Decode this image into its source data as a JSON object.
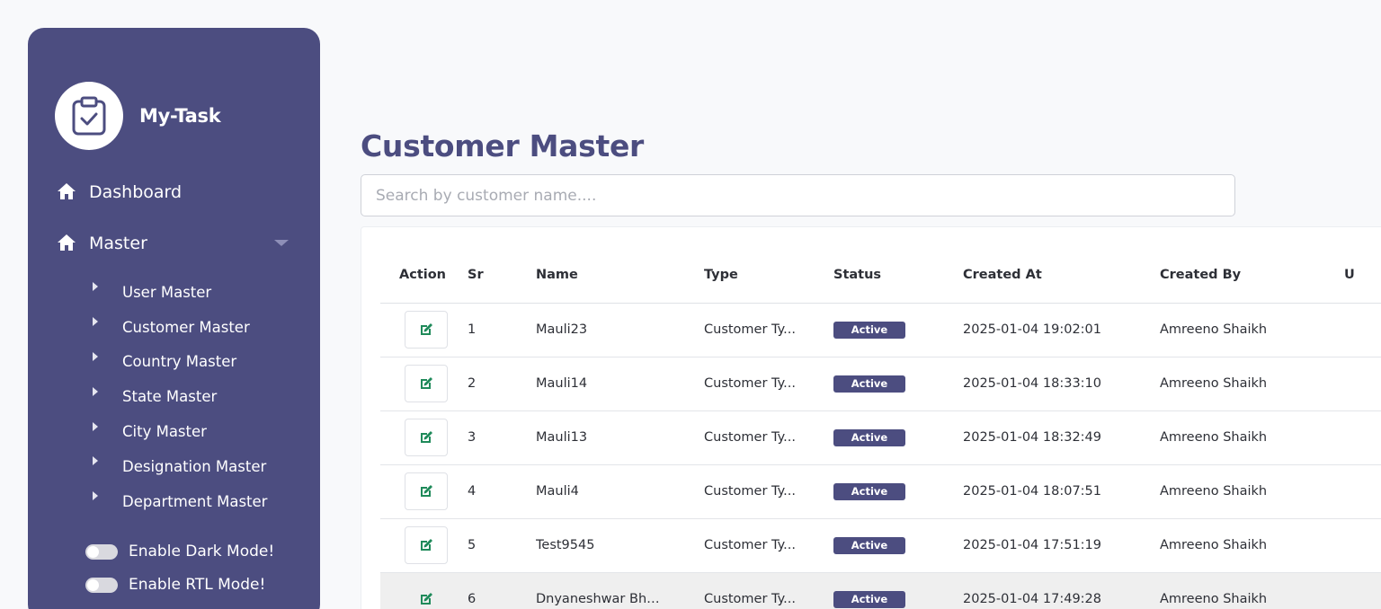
{
  "brand": {
    "name": "My-Task",
    "logo_icon": "clipboard-check-icon"
  },
  "sidebar": {
    "dashboard_label": "Dashboard",
    "master_label": "Master",
    "master_items": [
      "User Master",
      "Customer Master",
      "Country Master",
      "State Master",
      "City Master",
      "Designation Master",
      "Department Master"
    ],
    "dark_mode_label": "Enable Dark Mode!",
    "rtl_mode_label": "Enable RTL Mode!"
  },
  "main": {
    "title": "Customer Master",
    "search_placeholder": "Search by customer name....",
    "table": {
      "columns": [
        "Action",
        "Sr",
        "Name",
        "Type",
        "Status",
        "Created At",
        "Created By",
        "U"
      ],
      "rows": [
        {
          "sr": "1",
          "name": "Mauli23",
          "type": "Customer Ty...",
          "status": "Active",
          "created_at": "2025-01-04 19:02:01",
          "created_by": "Amreeno Shaikh"
        },
        {
          "sr": "2",
          "name": "Mauli14",
          "type": "Customer Ty...",
          "status": "Active",
          "created_at": "2025-01-04 18:33:10",
          "created_by": "Amreeno Shaikh"
        },
        {
          "sr": "3",
          "name": "Mauli13",
          "type": "Customer Ty...",
          "status": "Active",
          "created_at": "2025-01-04 18:32:49",
          "created_by": "Amreeno Shaikh"
        },
        {
          "sr": "4",
          "name": "Mauli4",
          "type": "Customer Ty...",
          "status": "Active",
          "created_at": "2025-01-04 18:07:51",
          "created_by": "Amreeno Shaikh"
        },
        {
          "sr": "5",
          "name": "Test9545",
          "type": "Customer Ty...",
          "status": "Active",
          "created_at": "2025-01-04 17:51:19",
          "created_by": "Amreeno Shaikh"
        },
        {
          "sr": "6",
          "name": "Dnyaneshwar Bhil...",
          "type": "Customer Ty...",
          "status": "Active",
          "created_at": "2025-01-04 17:49:28",
          "created_by": "Amreeno Shaikh"
        }
      ]
    }
  },
  "colors": {
    "primary": "#4c4d80",
    "edit_icon": "#1f8a5a",
    "background": "#f8f9fb"
  }
}
